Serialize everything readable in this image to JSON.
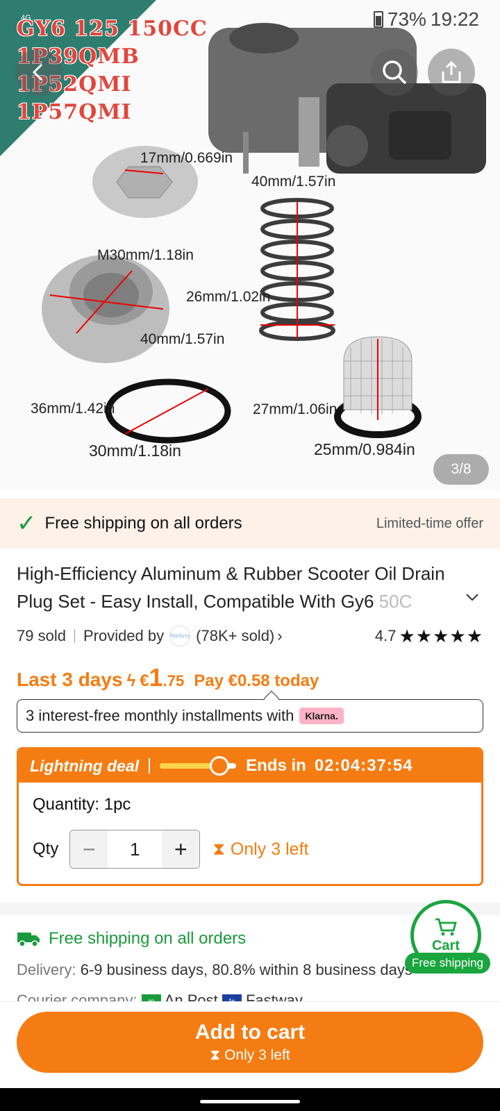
{
  "status": {
    "network": "4G",
    "battery": "73%",
    "time": "19:22"
  },
  "hero": {
    "badge_lines": [
      "GY6 125 150CC",
      "1P39QMB",
      "1P52QMI",
      "1P57QMI"
    ],
    "measurements": [
      "17mm/0.669in",
      "40mm/1.57in",
      "M30mm/1.18in",
      "26mm/1.02in",
      "40mm/1.57in",
      "36mm/1.42in",
      "27mm/1.06in",
      "30mm/1.18in",
      "25mm/0.984in"
    ],
    "counter": "3/8"
  },
  "shipping_banner": {
    "text": "Free shipping on all orders",
    "offer": "Limited-time offer"
  },
  "product": {
    "title": "High-Efficiency Aluminum & Rubber Scooter Oil Drain Plug Set - Easy Install, Compatible With Gy6",
    "title_fade": "50C",
    "sold": "79 sold",
    "provided_by": "Provided by",
    "store_logo_text": "Nanlysy",
    "store_sold": "(78K+ sold)",
    "rating": "4.7",
    "rating_stars": 4.7
  },
  "price": {
    "label": "Last 3 days",
    "currency": "€",
    "whole": "1",
    "cents": ".75",
    "pay_today": "Pay €0.58 today"
  },
  "installments": {
    "text": "3 interest-free monthly installments with",
    "provider": "Klarna."
  },
  "deal": {
    "label": "Lightning deal",
    "progress": 0.78,
    "ends_label": "Ends in",
    "timer": "02:04:37:54",
    "quantity_label": "Quantity: 1pc",
    "qty_label": "Qty",
    "qty_value": "1",
    "stock_warning": "Only 3 left"
  },
  "shipping_info": {
    "title": "Free shipping on all orders",
    "delivery_label": "Delivery:",
    "delivery_value": "6-9 business days, 80.8% within 8 business days",
    "courier_label": "Courier company:",
    "couriers": [
      "An Post",
      "Fastway"
    ]
  },
  "cart_fab": {
    "label": "Cart",
    "pill": "Free shipping"
  },
  "bottom": {
    "add_to_cart": "Add to cart",
    "stock_warning": "Only 3 left"
  },
  "colors": {
    "accent": "#f57c12",
    "green": "#1a9a3c",
    "banner_bg": "#fdf1e8",
    "corner_teal": "#2e7d6f"
  }
}
